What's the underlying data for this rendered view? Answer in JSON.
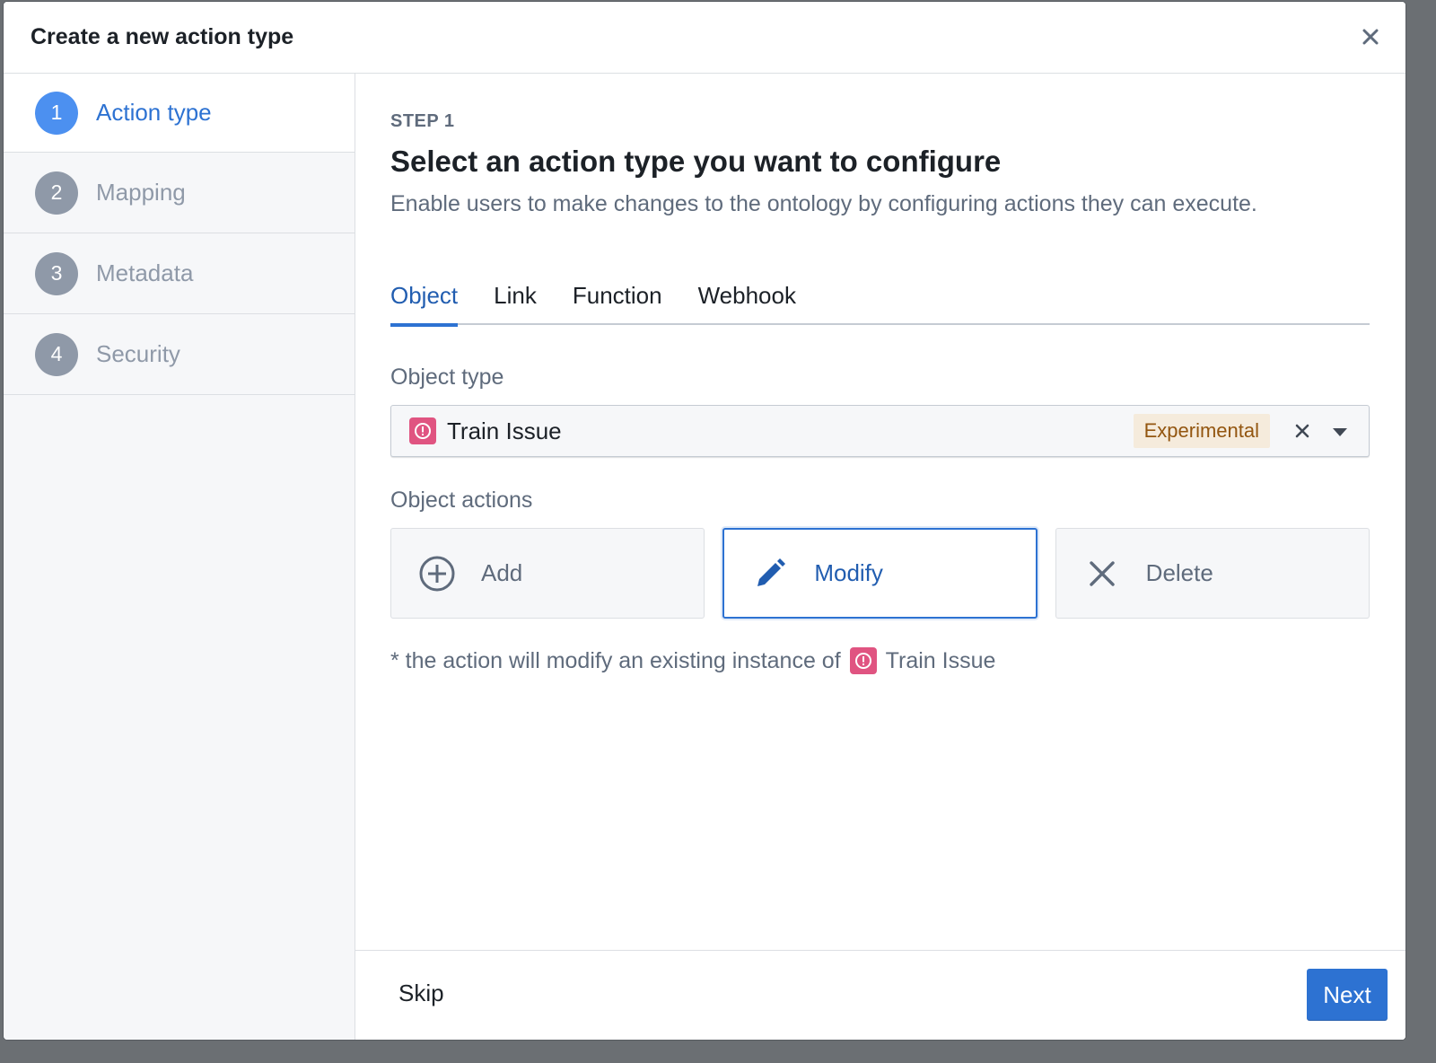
{
  "dialog": {
    "title": "Create a new action type",
    "close_icon": "close-icon"
  },
  "sidebar": {
    "steps": [
      {
        "number": "1",
        "label": "Action type",
        "active": true
      },
      {
        "number": "2",
        "label": "Mapping",
        "active": false
      },
      {
        "number": "3",
        "label": "Metadata",
        "active": false
      },
      {
        "number": "4",
        "label": "Security",
        "active": false
      }
    ]
  },
  "main": {
    "step_kicker": "STEP 1",
    "heading": "Select an action type you want to configure",
    "subtitle": "Enable users to make changes to the ontology by configuring actions they can execute.",
    "tabs": [
      {
        "label": "Object",
        "active": true
      },
      {
        "label": "Link",
        "active": false
      },
      {
        "label": "Function",
        "active": false
      },
      {
        "label": "Webhook",
        "active": false
      }
    ],
    "object_type": {
      "label": "Object type",
      "value": "Train Issue",
      "badge": "Experimental",
      "icon": "alert-circle-icon"
    },
    "object_actions": {
      "label": "Object actions",
      "options": [
        {
          "label": "Add",
          "icon": "plus-circle-icon",
          "selected": false
        },
        {
          "label": "Modify",
          "icon": "pencil-icon",
          "selected": true
        },
        {
          "label": "Delete",
          "icon": "cross-icon",
          "selected": false
        }
      ]
    },
    "note": {
      "prefix": "* the action will modify an existing instance of",
      "object": "Train Issue"
    }
  },
  "footer": {
    "skip_label": "Skip",
    "next_label": "Next"
  },
  "colors": {
    "primary": "#2d72d2",
    "object_icon": "#e05481",
    "badge_bg": "#f5ebdc",
    "badge_text": "#935610"
  }
}
